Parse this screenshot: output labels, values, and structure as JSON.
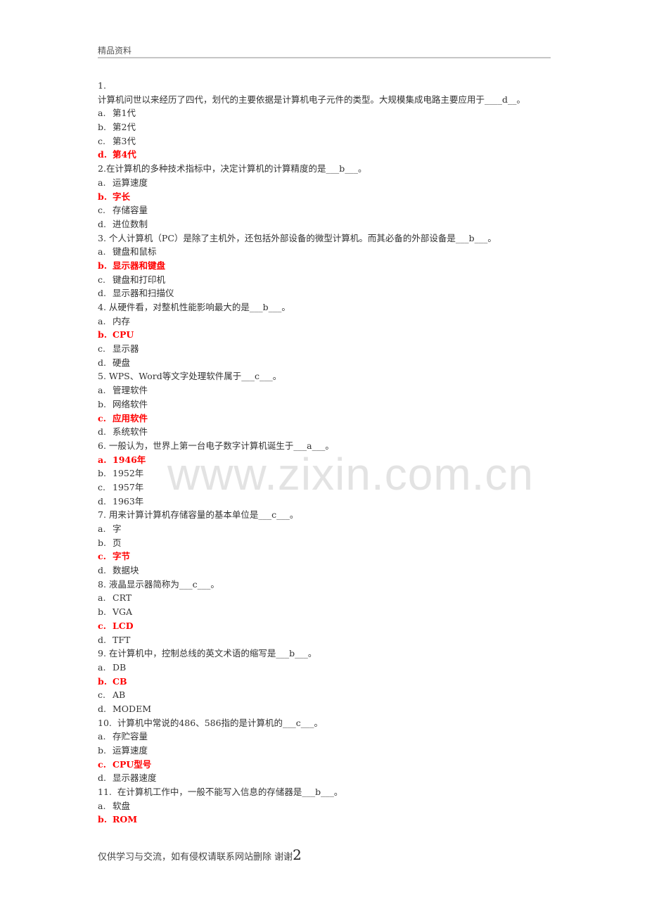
{
  "header": {
    "text": "精品资料"
  },
  "watermark": "www.zixin.com.cn",
  "colors": {
    "correct_answer": "#ff0000",
    "text": "#333333",
    "header_rule": "#c6c6c6"
  },
  "questions": [
    {
      "number": "1.",
      "stem": "计算机问世以来经历了四代，划代的主要依据是计算机电子元件的类型。大规模集成电路主要应用于____d__。",
      "options": [
        {
          "label": "a.",
          "text": "第1代",
          "correct": false
        },
        {
          "label": "b.",
          "text": "第2代",
          "correct": false
        },
        {
          "label": "c.",
          "text": "第3代",
          "correct": false
        },
        {
          "label": "d.",
          "text": "第4代",
          "correct": true
        }
      ]
    },
    {
      "number": "2.",
      "stem": "在计算机的多种技术指标中，决定计算机的计算精度的是___b___。",
      "options": [
        {
          "label": "a.",
          "text": "运算速度",
          "correct": false
        },
        {
          "label": "b.",
          "text": "字长",
          "correct": true
        },
        {
          "label": "c.",
          "text": "存储容量",
          "correct": false
        },
        {
          "label": "d.",
          "text": "进位数制",
          "correct": false
        }
      ]
    },
    {
      "number": "3.",
      "stem": "个人计算机（PC）是除了主机外，还包括外部设备的微型计算机。而其必备的外部设备是___b___。",
      "options": [
        {
          "label": "a.",
          "text": "键盘和鼠标",
          "correct": false
        },
        {
          "label": "b.",
          "text": "显示器和键盘",
          "correct": true
        },
        {
          "label": "c.",
          "text": "键盘和打印机",
          "correct": false
        },
        {
          "label": "d.",
          "text": "显示器和扫描仪",
          "correct": false
        }
      ]
    },
    {
      "number": "4.",
      "stem": "从硬件看，对整机性能影响最大的是___b___。",
      "options": [
        {
          "label": "a.",
          "text": "内存",
          "correct": false
        },
        {
          "label": "b.",
          "text": "CPU",
          "correct": true
        },
        {
          "label": "c.",
          "text": "显示器",
          "correct": false
        },
        {
          "label": "d.",
          "text": "硬盘",
          "correct": false
        }
      ]
    },
    {
      "number": "5.",
      "stem": "WPS、Word等文字处理软件属于___c___。",
      "options": [
        {
          "label": "a.",
          "text": "管理软件",
          "correct": false
        },
        {
          "label": "b.",
          "text": "网络软件",
          "correct": false
        },
        {
          "label": "c.",
          "text": "应用软件",
          "correct": true
        },
        {
          "label": "d.",
          "text": "系统软件",
          "correct": false
        }
      ]
    },
    {
      "number": "6.",
      "stem": "一般认为，世界上第一台电子数字计算机诞生于___a___。",
      "options": [
        {
          "label": "a.",
          "text": "1946年",
          "correct": true
        },
        {
          "label": "b.",
          "text": "1952年",
          "correct": false
        },
        {
          "label": "c.",
          "text": "1957年",
          "correct": false
        },
        {
          "label": "d.",
          "text": "1963年",
          "correct": false
        }
      ]
    },
    {
      "number": "7.",
      "stem": "用来计算计算机存储容量的基本单位是___c___。",
      "options": [
        {
          "label": "a.",
          "text": "字",
          "correct": false
        },
        {
          "label": "b.",
          "text": "页",
          "correct": false
        },
        {
          "label": "c.",
          "text": "字节",
          "correct": true
        },
        {
          "label": "d.",
          "text": "数据块",
          "correct": false
        }
      ]
    },
    {
      "number": "8.",
      "stem": "液晶显示器简称为___c___。",
      "options": [
        {
          "label": "a.",
          "text": "CRT",
          "correct": false
        },
        {
          "label": "b.",
          "text": "VGA",
          "correct": false
        },
        {
          "label": "c.",
          "text": "LCD",
          "correct": true
        },
        {
          "label": "d.",
          "text": "TFT",
          "correct": false
        }
      ]
    },
    {
      "number": "9.",
      "stem": "在计算机中，控制总线的英文术语的缩写是___b___。",
      "options": [
        {
          "label": "a.",
          "text": "DB",
          "correct": false
        },
        {
          "label": "b.",
          "text": "CB",
          "correct": true
        },
        {
          "label": "c.",
          "text": "AB",
          "correct": false
        },
        {
          "label": "d.",
          "text": "MODEM",
          "correct": false
        }
      ]
    },
    {
      "number": "10.",
      "stem": "计算机中常说的486、586指的是计算机的___c___。",
      "options": [
        {
          "label": "a.",
          "text": "存贮容量",
          "correct": false
        },
        {
          "label": "b.",
          "text": "运算速度",
          "correct": false
        },
        {
          "label": "c.",
          "text": "CPU型号",
          "correct": true
        },
        {
          "label": "d.",
          "text": "显示器速度",
          "correct": false
        }
      ]
    },
    {
      "number": "11.",
      "stem": "在计算机工作中，一般不能写入信息的存储器是___b___。",
      "options": [
        {
          "label": "a.",
          "text": "软盘",
          "correct": false
        },
        {
          "label": "b.",
          "text": "ROM",
          "correct": true
        }
      ]
    }
  ],
  "footer": {
    "text": "仅供学习与交流，如有侵权请联系网站删除 谢谢",
    "page_number": "2"
  }
}
